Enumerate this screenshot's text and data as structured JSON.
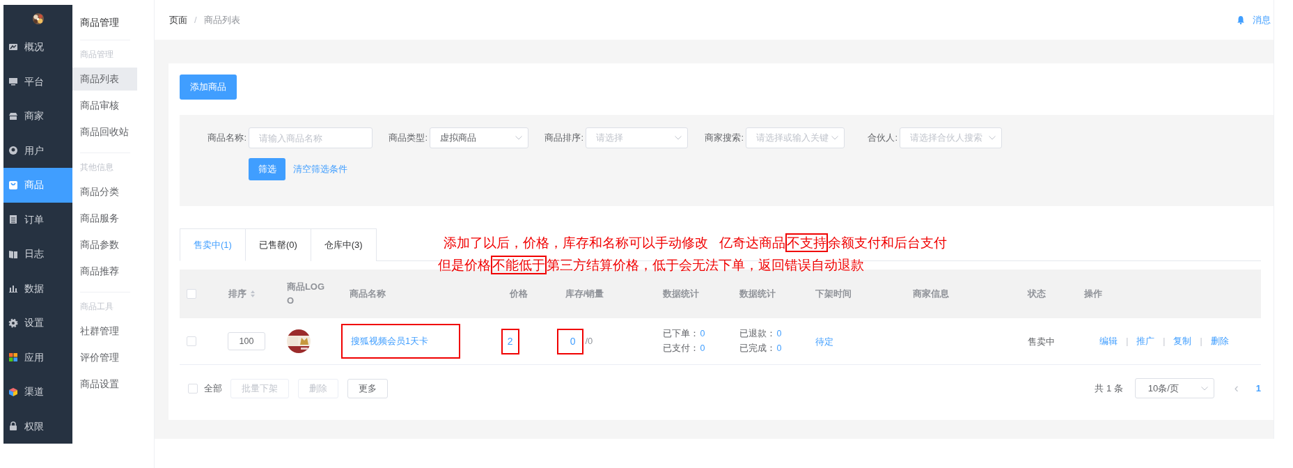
{
  "sidebar": {
    "items": [
      {
        "label": "概况",
        "selected": false
      },
      {
        "label": "平台",
        "selected": false
      },
      {
        "label": "商家",
        "selected": false
      },
      {
        "label": "用户",
        "selected": false
      },
      {
        "label": "商品",
        "selected": true
      },
      {
        "label": "订单",
        "selected": false
      },
      {
        "label": "日志",
        "selected": false
      },
      {
        "label": "数据",
        "selected": false
      },
      {
        "label": "设置",
        "selected": false
      },
      {
        "label": "应用",
        "selected": false
      },
      {
        "label": "渠道",
        "selected": false
      },
      {
        "label": "权限",
        "selected": false
      }
    ]
  },
  "submenu": {
    "title": "商品管理",
    "groups": [
      {
        "label": "商品管理",
        "items": [
          {
            "label": "商品列表",
            "selected": true
          },
          {
            "label": "商品审核",
            "selected": false
          },
          {
            "label": "商品回收站",
            "selected": false
          }
        ]
      },
      {
        "label": "其他信息",
        "items": [
          {
            "label": "商品分类",
            "selected": false
          },
          {
            "label": "商品服务",
            "selected": false
          },
          {
            "label": "商品参数",
            "selected": false
          },
          {
            "label": "商品推荐",
            "selected": false
          }
        ]
      },
      {
        "label": "商品工具",
        "items": [
          {
            "label": "社群管理",
            "selected": false
          },
          {
            "label": "评价管理",
            "selected": false
          },
          {
            "label": "商品设置",
            "selected": false
          }
        ]
      }
    ]
  },
  "header": {
    "breadcrumb": [
      "页面",
      "商品列表"
    ],
    "separator": "/",
    "messages": "消息"
  },
  "add_button": "添加商品",
  "filters": [
    {
      "label": "商品名称:",
      "kind": "input",
      "placeholder": "请输入商品名称"
    },
    {
      "label": "商品类型:",
      "kind": "select",
      "value": "虚拟商品"
    },
    {
      "label": "商品排序:",
      "kind": "select",
      "placeholder": "请选择"
    },
    {
      "label": "商家搜索:",
      "kind": "select",
      "placeholder": "请选择或输入关键"
    },
    {
      "label": "合伙人:",
      "kind": "select",
      "placeholder": "请选择合伙人搜索"
    }
  ],
  "filter_button": "筛选",
  "clear_link": "清空筛选条件",
  "tabs": [
    {
      "label": "售卖中(1)",
      "selected": true
    },
    {
      "label": "已售罄(0)",
      "selected": false
    },
    {
      "label": "仓库中(3)",
      "selected": false
    }
  ],
  "annotations": [
    [
      {
        "text": "添加了以后，价格，库存和名称可以手动修改   亿奇达商品",
        "boxed": false
      },
      {
        "text": "不支持",
        "boxed": true
      },
      {
        "text": "余额支付和后台支付",
        "boxed": false
      }
    ],
    [
      {
        "text": "但是价格",
        "boxed": false
      },
      {
        "text": "不能低于",
        "boxed": true
      },
      {
        "text": "第三方结算价格，低于会无法下单，返回错误自动退款",
        "boxed": false
      }
    ]
  ],
  "table": {
    "select_all_checked": false,
    "columns": [
      "排序",
      "商品LOGO",
      "商品名称",
      "价格",
      "库存/销量",
      "数据统计",
      "数据统计",
      "下架时间",
      "商家信息",
      "状态",
      "操作"
    ],
    "rows": [
      {
        "checked": false,
        "sort": "100",
        "name": "搜狐视频会员1天卡",
        "name_boxed": true,
        "price": "2",
        "price_boxed": true,
        "stock": "0",
        "stock_boxed": true,
        "sales": "/0",
        "stats_1": [
          {
            "label": "已下单：",
            "value": "0"
          },
          {
            "label": "已支付：",
            "value": "0"
          }
        ],
        "stats_2": [
          {
            "label": "已退款：",
            "value": "0"
          },
          {
            "label": "已完成：",
            "value": "0"
          }
        ],
        "off_time": "待定",
        "status": "售卖中",
        "actions": [
          "编辑",
          "推广",
          "复制",
          "删除"
        ],
        "action_separator": "|"
      }
    ]
  },
  "footer": {
    "select_all": {
      "label": "全部",
      "checked": false
    },
    "buttons": [
      {
        "label": "批量下架",
        "disabled": true
      },
      {
        "label": "删除",
        "disabled": true
      },
      {
        "label": "更多",
        "disabled": false
      }
    ],
    "total": "共 1 条",
    "page_size": "10条/页",
    "prev": "‹",
    "pages": [
      {
        "label": "1",
        "selected": true
      }
    ]
  }
}
